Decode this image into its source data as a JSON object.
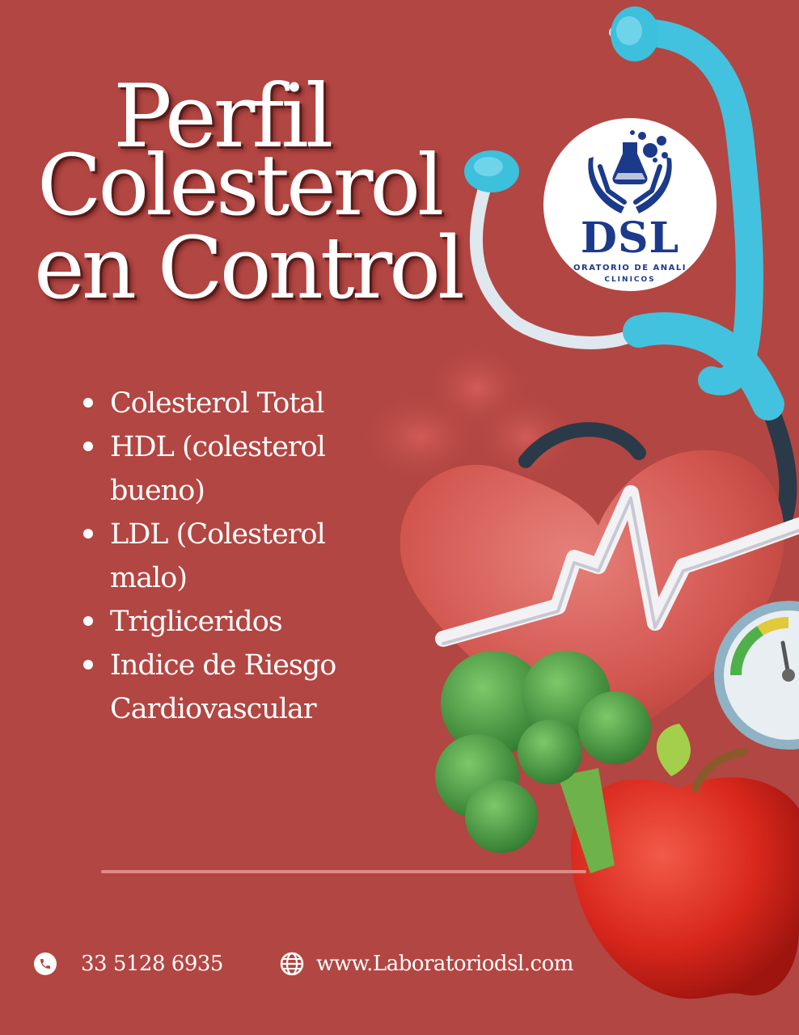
{
  "title": {
    "line1": "Perfil",
    "line2": "Colesterol",
    "line3": "en Control"
  },
  "tests": [
    {
      "label": "Colesterol Total"
    },
    {
      "label": "HDL (colesterol bueno)"
    },
    {
      "label": "LDL (Colesterol malo)"
    },
    {
      "label": "Trigliceridos"
    },
    {
      "label": "Indice de Riesgo Cardiovascular"
    }
  ],
  "logo": {
    "name": "DSL",
    "subtitle_line1": "ORATORIO DE ANALI",
    "subtitle_line2": "CLINICOS"
  },
  "contact": {
    "phone": "33 5128 6935",
    "website": "www.Laboratoriodsl.com"
  },
  "icons": {
    "phone": "phone-icon",
    "website": "globe-icon"
  },
  "colors": {
    "background": "#b24642",
    "text": "#ffffff",
    "brand": "#1c3a8c",
    "stethoscope": "#3cc0dc"
  }
}
